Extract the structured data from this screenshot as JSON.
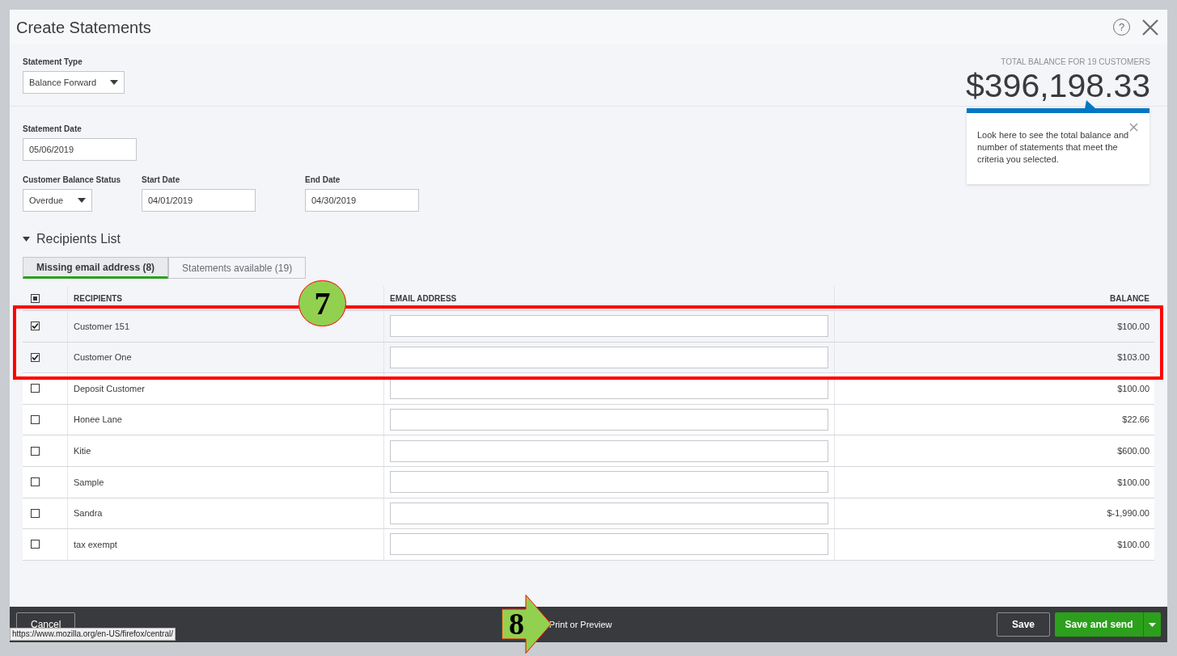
{
  "window": {
    "title": "Create Statements",
    "help_glyph": "?"
  },
  "statement_type": {
    "label": "Statement Type",
    "value": "Balance Forward"
  },
  "total": {
    "label": "TOTAL BALANCE FOR 19 CUSTOMERS",
    "amount": "$396,198.33"
  },
  "tip": {
    "text": "Look here to see the total balance and number of statements that meet the criteria you selected."
  },
  "statement_date": {
    "label": "Statement Date",
    "value": "05/06/2019"
  },
  "balance_status": {
    "label": "Customer Balance Status",
    "value": "Overdue"
  },
  "start_date": {
    "label": "Start Date",
    "value": "04/01/2019"
  },
  "end_date": {
    "label": "End Date",
    "value": "04/30/2019"
  },
  "recipients": {
    "title": "Recipients List",
    "expanded": true,
    "tabs": [
      {
        "label": "Missing email address (8)",
        "selected": true
      },
      {
        "label": "Statements available (19)",
        "selected": false
      }
    ],
    "select_all": {
      "indeterminate": true
    },
    "columns": [
      "RECIPIENTS",
      "EMAIL ADDRESS",
      "BALANCE"
    ],
    "rows": [
      {
        "checked": true,
        "name": "Customer 151",
        "balance": "$100.00"
      },
      {
        "checked": true,
        "name": "Customer One",
        "balance": "$103.00"
      },
      {
        "checked": false,
        "name": "Deposit Customer",
        "balance": "$100.00"
      },
      {
        "checked": false,
        "name": "Honee Lane",
        "balance": "$22.66"
      },
      {
        "checked": false,
        "name": "Kitie",
        "balance": "$600.00"
      },
      {
        "checked": false,
        "name": "Sample",
        "balance": "$100.00"
      },
      {
        "checked": false,
        "name": "Sandra",
        "balance": "$-1,990.00"
      },
      {
        "checked": false,
        "name": "tax exempt",
        "balance": "$100.00"
      }
    ]
  },
  "footer": {
    "cancel": "Cancel",
    "print": "Print or Preview",
    "save": "Save",
    "save_and_send": "Save and send"
  },
  "status_url": "https://www.mozilla.org/en-US/firefox/central/",
  "annotations": [
    {
      "kind": "circle",
      "label": "7"
    },
    {
      "kind": "arrow",
      "label": "8"
    }
  ]
}
